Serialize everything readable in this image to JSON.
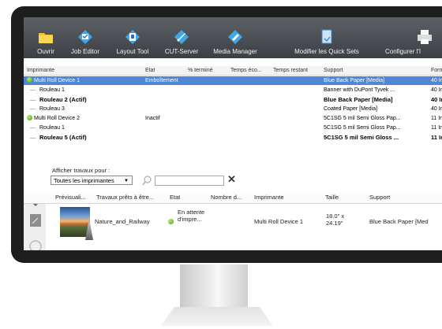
{
  "toolbar": {
    "items": [
      {
        "label": "Ouvrir",
        "icon": "folder-icon"
      },
      {
        "label": "Job Editor",
        "icon": "job-editor-icon"
      },
      {
        "label": "Layout Tool",
        "icon": "layout-tool-icon"
      },
      {
        "label": "CUT-Server",
        "icon": "cut-server-icon"
      },
      {
        "label": "Media Manager",
        "icon": "media-manager-icon"
      },
      {
        "label": "Modifier les Quick Sets",
        "icon": "quick-sets-icon"
      },
      {
        "label": "Configurer l'I",
        "icon": "printer-icon"
      }
    ]
  },
  "printers_table": {
    "headers": [
      "Imprimante",
      "Etat",
      "% terminé",
      "Temps éco...",
      "Temps restant",
      "Support",
      "Form"
    ],
    "rows": [
      {
        "name": "Multi Roll Device 1",
        "state": "Emboîtement",
        "support": "Blue Back Paper [Media]",
        "format": "40 In"
      },
      {
        "name": "Rouleau 1",
        "state": "",
        "support": "Banner with DuPont Tyvek ...",
        "format": "40 In"
      },
      {
        "name": "Rouleau 2 (Actif)",
        "state": "",
        "support": "Blue Back Paper [Media]",
        "format": "40 In"
      },
      {
        "name": "Rouleau 3",
        "state": "",
        "support": "Coated Paper [Media]",
        "format": "40 In"
      },
      {
        "name": "Multi Roll Device 2",
        "state": "Inactif",
        "support": "5C1SG 5 mil Semi Gloss Pap...",
        "format": "11 In"
      },
      {
        "name": "Rouleau 1",
        "state": "",
        "support": "5C1SG 5 mil Semi Gloss Pap...",
        "format": "11 In"
      },
      {
        "name": "Rouleau 5 (Actif)",
        "state": "",
        "support": "5C1SG 5 mil Semi Gloss ...",
        "format": "11 In"
      }
    ]
  },
  "filter": {
    "label": "Afficher travaux pour :",
    "selected": "Toutes les imprimantes"
  },
  "jobs_table": {
    "headers": [
      "Prévisuali...",
      "Travaux prêts à être...",
      "Etat",
      "Nombre d...",
      "Imprimante",
      "Taille",
      "Support"
    ],
    "rows": [
      {
        "name": "Nature_and_Railway",
        "state": "En attente d'impre...",
        "printer": "Multi Roll Device 1",
        "size": "18.0\" x 24.19\"",
        "support": "Blue Back Paper [Med"
      }
    ]
  },
  "colors": {
    "selection": "#4f86d6",
    "toolbar": "#4a4e52",
    "status_ok": "#3c9a1a"
  }
}
